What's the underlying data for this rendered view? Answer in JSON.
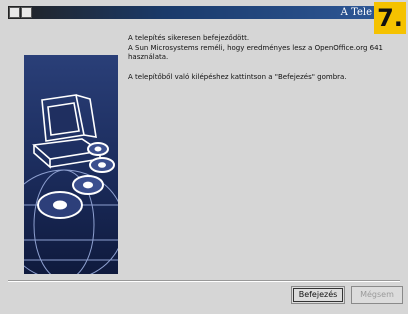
{
  "window": {
    "title": "A Tele"
  },
  "badge": "7.",
  "content": {
    "line1": "A telepítés sikeresen befejeződött.",
    "line2": "A Sun Microsystems reméli, hogy eredményes lesz a OpenOffice.org 641 használata.",
    "line3": "A telepítőből való kilépéshez kattintson a \"Befejezés\" gombra."
  },
  "buttons": {
    "finish": "Befejezés",
    "cancel": "Mégsem"
  },
  "icons": [
    "computer-icon",
    "disc-icon",
    "globe-graphic"
  ]
}
